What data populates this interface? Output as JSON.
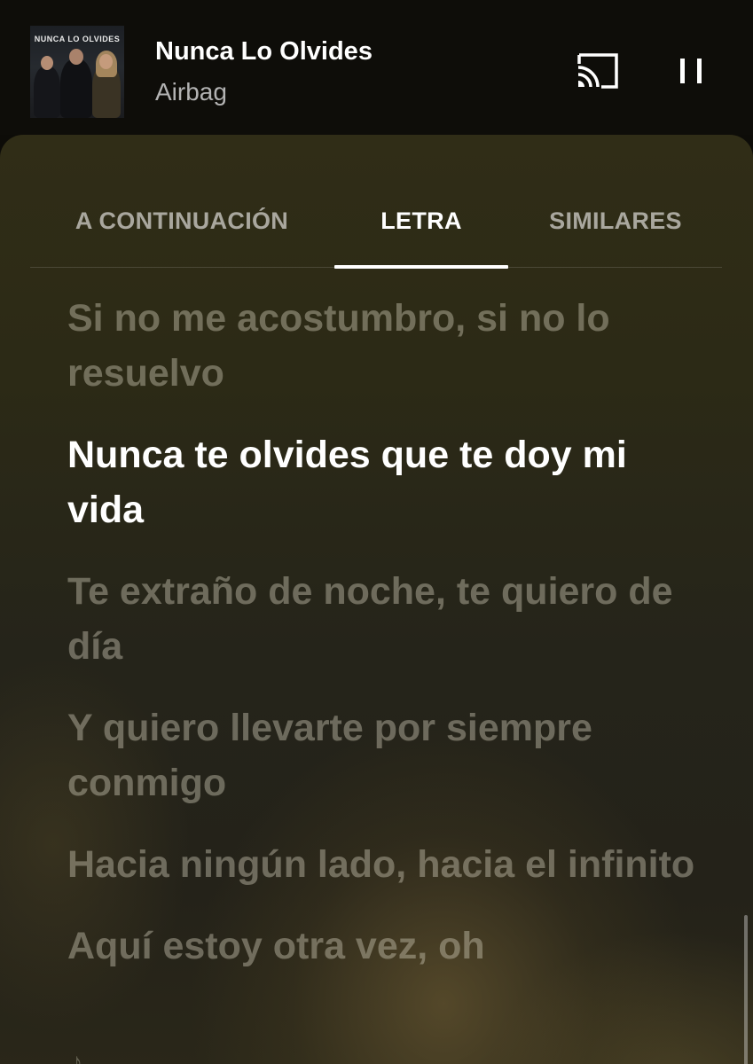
{
  "player": {
    "album_art_text": "NUNCA LO OLVIDES",
    "title": "Nunca Lo Olvides",
    "artist": "Airbag",
    "cast_icon": "cast-icon",
    "pause_icon": "pause-icon"
  },
  "tabs": [
    {
      "label": "A CONTINUACIÓN",
      "selected": false
    },
    {
      "label": "LETRA",
      "selected": true
    },
    {
      "label": "SIMILARES",
      "selected": false
    }
  ],
  "lyrics": [
    {
      "text": "Si no me acostumbro, si no lo resuelvo",
      "active": false
    },
    {
      "text": "Nunca te olvides que te doy mi vida",
      "active": true
    },
    {
      "text": "Te extraño de noche, te quiero de día",
      "active": false
    },
    {
      "text": "Y quiero llevarte por siempre conmigo",
      "active": false
    },
    {
      "text": "Hacia ningún lado, hacia el infinito",
      "active": false
    },
    {
      "text": "Aquí estoy otra vez, oh",
      "active": false
    }
  ],
  "colors": {
    "active_lyric": "#ffffff",
    "inactive_lyric": "rgba(210,205,185,0.42)",
    "sheet_background": "#2c2a16"
  }
}
